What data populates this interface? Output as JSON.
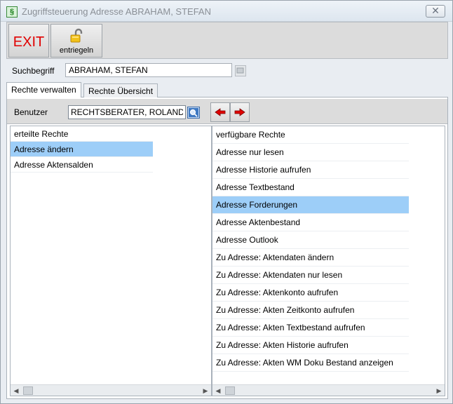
{
  "window": {
    "title": "Zugriffsteuerung Adresse ABRAHAM, STEFAN",
    "close_symbol": "✕",
    "app_icon_symbol": "§"
  },
  "toolbar": {
    "exit_label": "EXIT",
    "unlock_label": "entriegeln"
  },
  "search": {
    "label": "Suchbegriff",
    "value": "ABRAHAM, STEFAN"
  },
  "tabs": [
    {
      "label": "Rechte verwalten",
      "active": true
    },
    {
      "label": "Rechte Übersicht",
      "active": false
    }
  ],
  "user": {
    "label": "Benutzer",
    "value": "RECHTSBERATER, ROLAND"
  },
  "granted": {
    "header": "erteilte Rechte",
    "items": [
      "Adresse ändern",
      "Adresse Aktensalden"
    ],
    "selected_index": 0
  },
  "available": {
    "header": "verfügbare Rechte",
    "items": [
      "Adresse nur lesen",
      "Adresse Historie aufrufen",
      "Adresse Textbestand",
      "Adresse Forderungen",
      "Adresse Aktenbestand",
      "Adresse Outlook",
      "Zu Adresse: Aktendaten ändern",
      "Zu Adresse: Aktendaten nur lesen",
      "Zu Adresse: Aktenkonto aufrufen",
      "Zu Adresse: Akten Zeitkonto aufrufen",
      "Zu Adresse: Akten Textbestand aufrufen",
      "Zu Adresse: Akten Historie aufrufen",
      "Zu Adresse: Akten WM Doku Bestand anzeigen"
    ],
    "selected_index": 3
  },
  "colors": {
    "selection": "#9dcef8",
    "exit_red": "#e00000",
    "arrow_red": "#e00000"
  },
  "icons": {
    "app": "app-icon",
    "unlock": "unlock-icon",
    "search": "search-icon",
    "arrow_left": "arrow-left-icon",
    "arrow_right": "arrow-right-icon"
  }
}
